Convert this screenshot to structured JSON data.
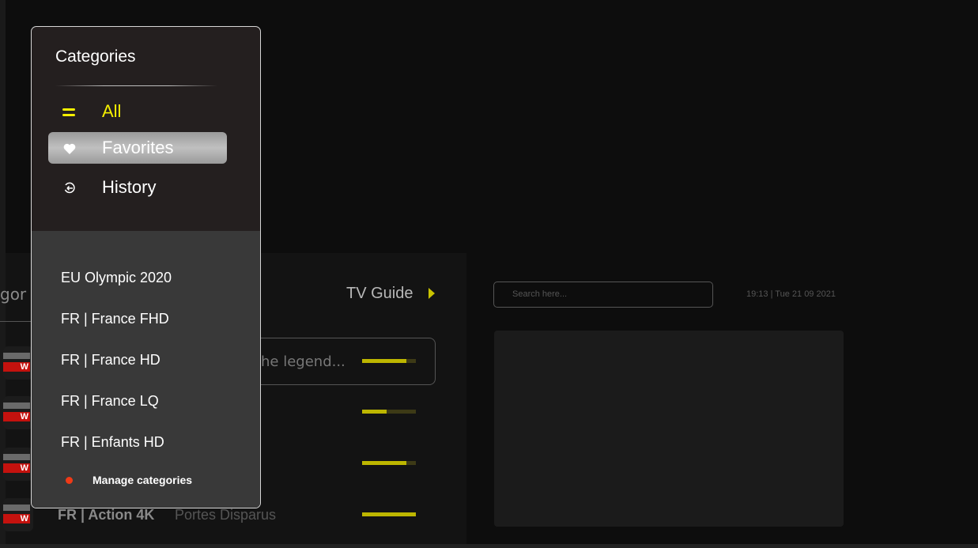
{
  "background": {
    "categories_label": "gor",
    "tv_guide_label": "TV Guide",
    "search_placeholder": "Search here...",
    "clock_text": "19:13 | Tue 21 09 2021",
    "channel_description": "he legend...",
    "last_row": {
      "title": "FR | Action 4K",
      "subtitle": "Portes Disparus"
    },
    "logo_text": "W",
    "progress": [
      0.82,
      0.45,
      0.82,
      1.0
    ]
  },
  "popup": {
    "title": "Categories",
    "menu": [
      {
        "label": "All",
        "icon": "list-icon",
        "color": "#f5ef00"
      },
      {
        "label": "Favorites",
        "icon": "heart-icon",
        "color": "#ffffff",
        "selected": true
      },
      {
        "label": "History",
        "icon": "history-icon",
        "color": "#ffffff"
      }
    ],
    "categories": [
      "EU Olympic 2020",
      "FR | France FHD",
      "FR | France HD",
      "FR | France LQ",
      "FR | Enfants HD"
    ],
    "manage_label": "Manage categories"
  },
  "colors": {
    "accent": "#f5ef00",
    "manage_dot": "#f03a17",
    "progress": "#bdb600"
  }
}
